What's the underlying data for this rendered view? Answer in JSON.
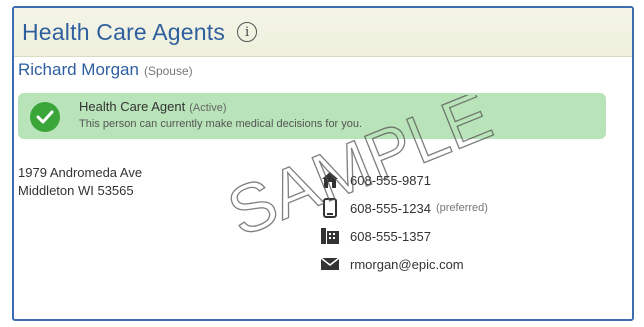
{
  "panel": {
    "title": "Health Care Agents",
    "info_icon": "info-icon"
  },
  "agent": {
    "name": "Richard Morgan",
    "relationship": "(Spouse)"
  },
  "status": {
    "title": "Health Care Agent",
    "state": "(Active)",
    "description": "This person can currently make medical decisions for you.",
    "color": "#b9e3b9",
    "check_color": "#3aa63a"
  },
  "address": {
    "line1": "1979 Andromeda Ave",
    "line2": "Middleton WI 53565"
  },
  "contacts": {
    "home_phone": "608-555-9871",
    "mobile_phone": "608-555-1234",
    "mobile_note": "(preferred)",
    "work_phone": "608-555-1357",
    "email": "rmorgan@epic.com"
  },
  "watermark": {
    "text": "SAMPLE"
  },
  "colors": {
    "accent": "#2f5f9f",
    "border": "#3d6cb3"
  }
}
